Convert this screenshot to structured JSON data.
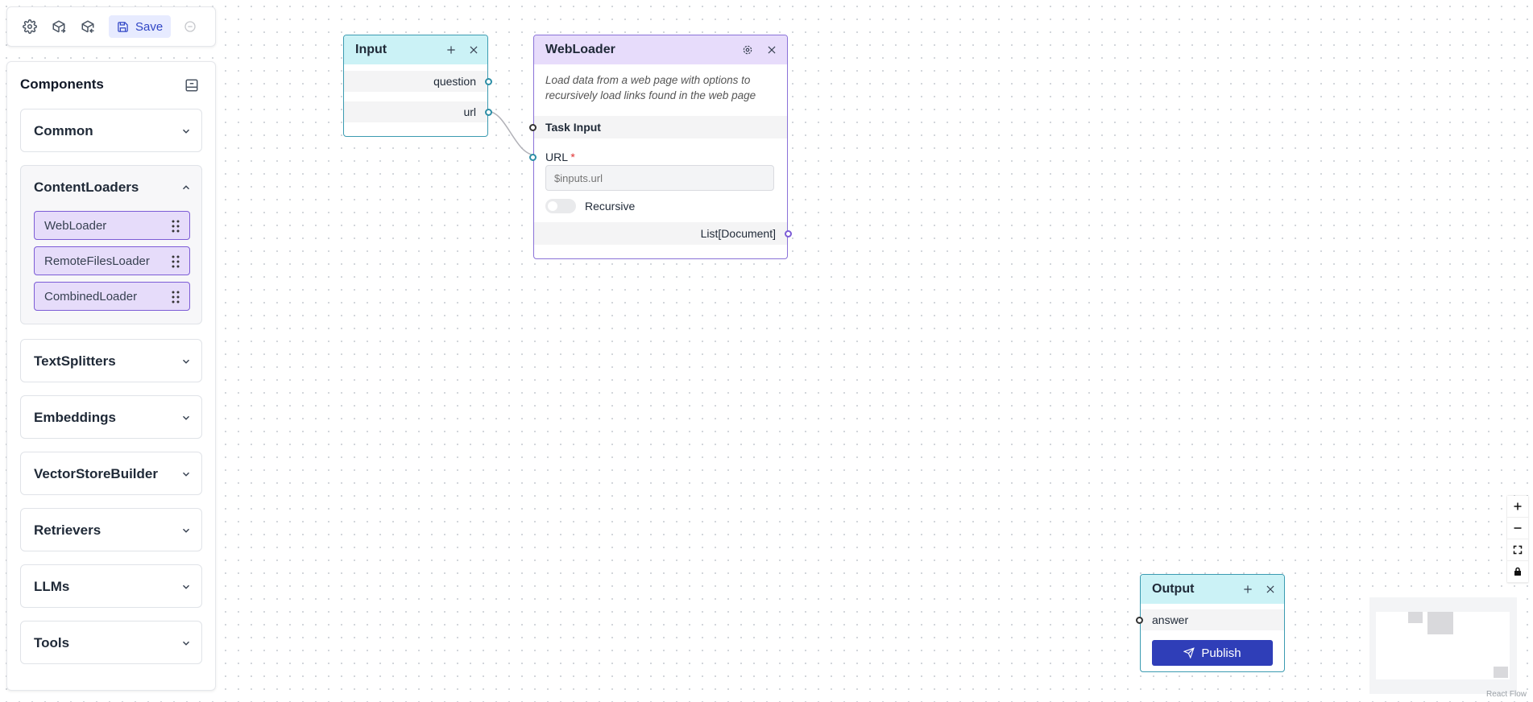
{
  "toolbar": {
    "settings_icon": "gear-icon",
    "export_icon": "cube-export-icon",
    "import_icon": "cube-import-icon",
    "save_label": "Save",
    "status_icon": "circle-dashed-icon"
  },
  "sidebar": {
    "title": "Components",
    "categories": [
      {
        "label": "Common",
        "expanded": false
      },
      {
        "label": "ContentLoaders",
        "expanded": true,
        "items": [
          "WebLoader",
          "RemoteFilesLoader",
          "CombinedLoader"
        ]
      },
      {
        "label": "TextSplitters",
        "expanded": false
      },
      {
        "label": "Embeddings",
        "expanded": false
      },
      {
        "label": "VectorStoreBuilder",
        "expanded": false
      },
      {
        "label": "Retrievers",
        "expanded": false
      },
      {
        "label": "LLMs",
        "expanded": false
      },
      {
        "label": "Tools",
        "expanded": false
      }
    ]
  },
  "nodes": {
    "input": {
      "title": "Input",
      "fields": [
        "question",
        "url"
      ]
    },
    "webloader": {
      "title": "WebLoader",
      "description": "Load data from a web page with options to recursively load links found in the web page",
      "task_input_label": "Task Input",
      "url_label": "URL",
      "required_mark": "*",
      "url_placeholder": "$inputs.url",
      "recursive_label": "Recursive",
      "recursive_on": false,
      "output_label": "List[Document]"
    },
    "output": {
      "title": "Output",
      "field": "answer",
      "publish_label": "Publish"
    }
  },
  "colors": {
    "io_node_header": "#cbf2f6",
    "loader_node_header": "#e7dcfb",
    "component_item_bg": "#e6dcfa",
    "publish_button": "#2f3eb8"
  },
  "attribution": "React Flow"
}
